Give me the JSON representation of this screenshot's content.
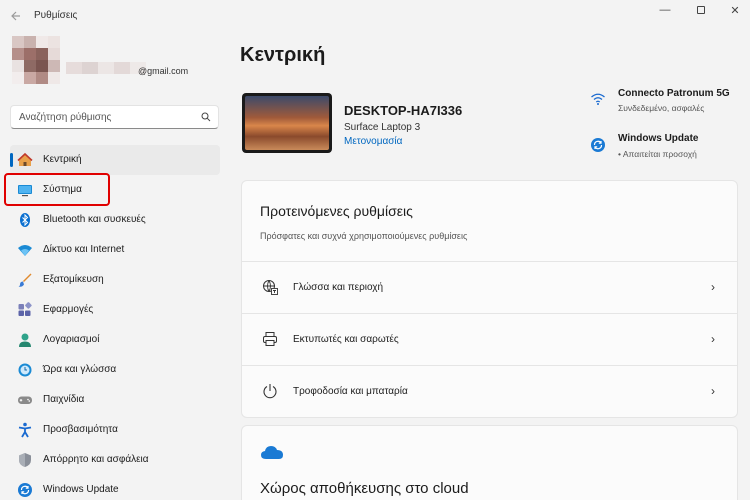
{
  "window": {
    "title": "Ρυθμίσεις",
    "back_icon": "back-arrow-icon",
    "minimize_glyph": "—",
    "close_glyph": "✕"
  },
  "profile": {
    "email_suffix": "@gmail.com"
  },
  "search": {
    "placeholder": "Αναζήτηση ρύθμισης",
    "icon": "search-icon"
  },
  "sidebar": {
    "items": [
      {
        "label": "Κεντρική",
        "icon": "home-icon",
        "active": true
      },
      {
        "label": "Σύστημα",
        "icon": "system-icon",
        "active": false
      },
      {
        "label": "Bluetooth και συσκευές",
        "icon": "bluetooth-icon",
        "active": false
      },
      {
        "label": "Δίκτυο και Internet",
        "icon": "network-icon",
        "active": false
      },
      {
        "label": "Εξατομίκευση",
        "icon": "brush-icon",
        "active": false
      },
      {
        "label": "Εφαρμογές",
        "icon": "apps-icon",
        "active": false
      },
      {
        "label": "Λογαριασμοί",
        "icon": "accounts-icon",
        "active": false
      },
      {
        "label": "Ώρα και γλώσσα",
        "icon": "time-language-icon",
        "active": false
      },
      {
        "label": "Παιχνίδια",
        "icon": "gaming-icon",
        "active": false
      },
      {
        "label": "Προσβασιμότητα",
        "icon": "accessibility-icon",
        "active": false
      },
      {
        "label": "Απόρρητο και ασφάλεια",
        "icon": "shield-icon",
        "active": false
      },
      {
        "label": "Windows Update",
        "icon": "windows-update-icon",
        "active": false
      }
    ]
  },
  "main": {
    "title": "Κεντρική",
    "device": {
      "name": "DESKTOP-HA7I336",
      "model": "Surface Laptop 3",
      "rename_link": "Μετονομασία"
    },
    "status": {
      "network_title": "Connecto Patronum 5G",
      "network_sub": "Συνδεδεμένο, ασφαλές",
      "update_title": "Windows Update",
      "update_sub": "• Απαιτείται προσοχή"
    },
    "recommended": {
      "title": "Προτεινόμενες ρυθμίσεις",
      "subtitle": "Πρόσφατες και συχνά χρησιμοποιούμενες ρυθμίσεις",
      "rows": [
        {
          "label": "Γλώσσα και περιοχή",
          "icon": "language-region-icon"
        },
        {
          "label": "Εκτυπωτές και σαρωτές",
          "icon": "printer-icon"
        },
        {
          "label": "Τροφοδοσία και μπαταρία",
          "icon": "power-icon"
        }
      ],
      "chevron": "›"
    },
    "cloud": {
      "title": "Χώρος αποθήκευσης στο cloud",
      "icon": "onedrive-cloud-icon"
    }
  },
  "colors": {
    "accent": "#0067c0",
    "highlight": "#e00000",
    "background": "#f3f3f3",
    "card": "#fbfbfb"
  }
}
